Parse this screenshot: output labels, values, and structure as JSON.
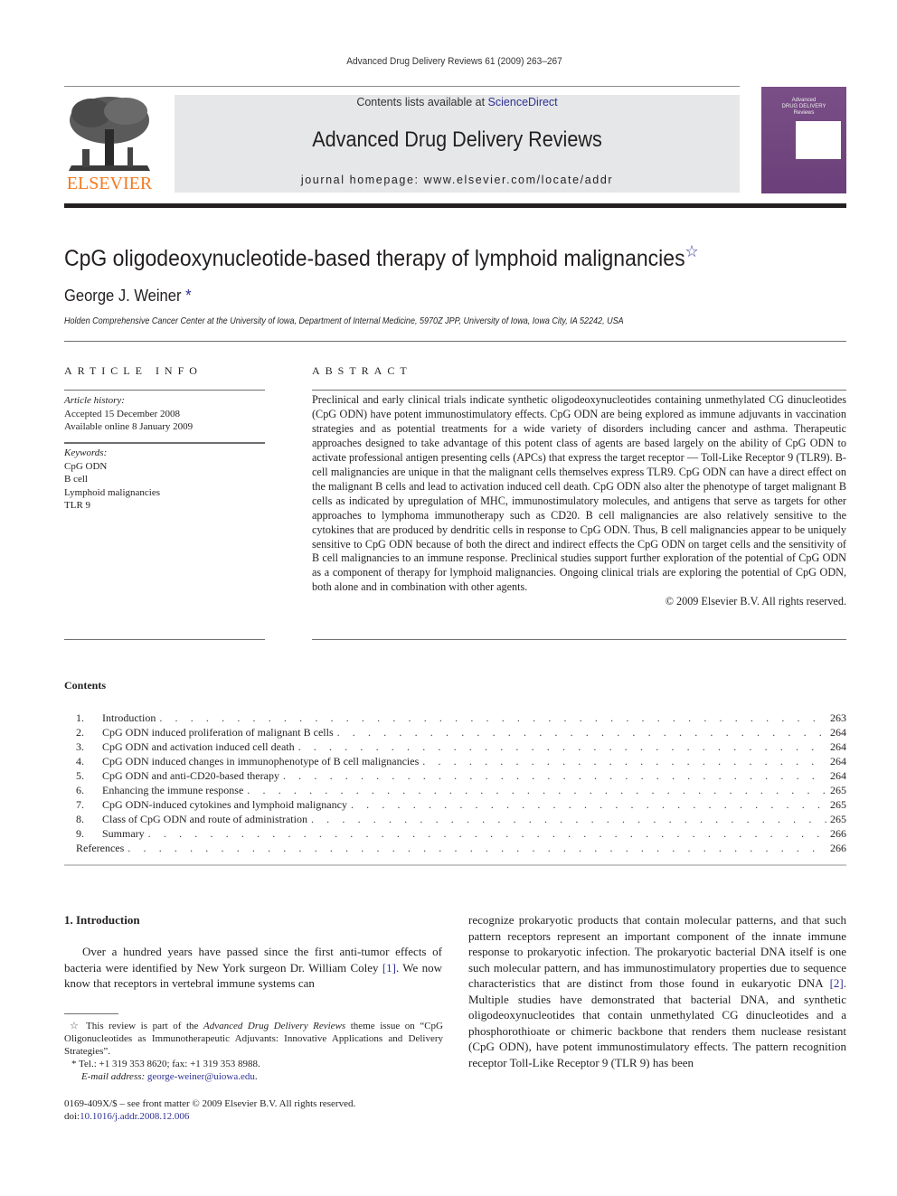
{
  "header": {
    "citation": "Advanced Drug Delivery Reviews 61 (2009) 263–267",
    "contents_prefix": "Contents lists available at ",
    "contents_link": "ScienceDirect",
    "journal_title": "Advanced Drug Delivery Reviews",
    "homepage": "journal homepage: www.elsevier.com/locate/addr",
    "publisher": "ELSEVIER",
    "cover_text_1": "Advanced",
    "cover_text_2": "DRUG DELIVERY",
    "cover_text_3": "Reviews"
  },
  "article": {
    "title": "CpG oligodeoxynucleotide-based therapy of lymphoid malignancies",
    "title_mark": "☆",
    "author": "George J. Weiner",
    "author_mark": "*",
    "affiliation": "Holden Comprehensive Cancer Center at the University of Iowa, Department of Internal Medicine, 5970Z JPP, University of Iowa, Iowa City, IA 52242, USA"
  },
  "article_info": {
    "heading": "ARTICLE INFO",
    "history_label": "Article history:",
    "accepted": "Accepted 15 December 2008",
    "online": "Available online 8 January 2009",
    "keywords_label": "Keywords:",
    "keywords": [
      "CpG ODN",
      "B cell",
      "Lymphoid malignancies",
      "TLR 9"
    ]
  },
  "abstract": {
    "heading": "ABSTRACT",
    "text": "Preclinical and early clinical trials indicate synthetic oligodeoxynucleotides containing unmethylated CG dinucleotides (CpG ODN) have potent immunostimulatory effects. CpG ODN are being explored as immune adjuvants in vaccination strategies and as potential treatments for a wide variety of disorders including cancer and asthma. Therapeutic approaches designed to take advantage of this potent class of agents are based largely on the ability of CpG ODN to activate professional antigen presenting cells (APCs) that express the target receptor — Toll-Like Receptor 9 (TLR9). B-cell malignancies are unique in that the malignant cells themselves express TLR9. CpG ODN can have a direct effect on the malignant B cells and lead to activation induced cell death. CpG ODN also alter the phenotype of target malignant B cells as indicated by upregulation of MHC, immunostimulatory molecules, and antigens that serve as targets for other approaches to lymphoma immunotherapy such as CD20. B cell malignancies are also relatively sensitive to the cytokines that are produced by dendritic cells in response to CpG ODN. Thus, B cell malignancies appear to be uniquely sensitive to CpG ODN because of both the direct and indirect effects the CpG ODN on target cells and the sensitivity of B cell malignancies to an immune response. Preclinical studies support further exploration of the potential of CpG ODN as a component of therapy for lymphoid malignancies. Ongoing clinical trials are exploring the potential of CpG ODN, both alone and in combination with other agents.",
    "copyright": "© 2009 Elsevier B.V. All rights reserved."
  },
  "contents": {
    "heading": "Contents",
    "items": [
      {
        "num": "1.",
        "title": "Introduction",
        "page": "263"
      },
      {
        "num": "2.",
        "title": "CpG ODN induced proliferation of malignant B cells",
        "page": "264"
      },
      {
        "num": "3.",
        "title": "CpG ODN and activation induced cell death",
        "page": "264"
      },
      {
        "num": "4.",
        "title": "CpG ODN induced changes in immunophenotype of B cell malignancies",
        "page": "264"
      },
      {
        "num": "5.",
        "title": "CpG ODN and anti-CD20-based therapy",
        "page": "264"
      },
      {
        "num": "6.",
        "title": "Enhancing the immune response",
        "page": "265"
      },
      {
        "num": "7.",
        "title": "CpG ODN-induced cytokines and lymphoid malignancy",
        "page": "265"
      },
      {
        "num": "8.",
        "title": "Class of CpG ODN and route of administration",
        "page": "265"
      },
      {
        "num": "9.",
        "title": "Summary",
        "page": "266"
      },
      {
        "num": "",
        "title": "References",
        "page": "266"
      }
    ],
    "dots": ". . . . . . . . . . . . . . . . . . . . . . . . . . . . . . . . . . . . . . . . . . . . . . . . . . . . . . . . . . . . . . . . . . . . . . . . . . . . . . . . . . . . . . . . . . . . . . . . . . . . . . . . . . . . . ."
  },
  "intro": {
    "heading": "1. Introduction",
    "col1_text": "Over a hundred years have passed since the first anti-tumor effects of bacteria were identified by New York surgeon Dr. William Coley ",
    "ref1": "[1]",
    "col1_tail": ". We now know that receptors in vertebral immune systems can",
    "col2_text": "recognize prokaryotic products that contain molecular patterns, and that such pattern receptors represent an important component of the innate immune response to prokaryotic infection. The prokaryotic bacterial DNA itself is one such molecular pattern, and has immunostimulatory properties due to sequence characteristics that are distinct from those found in eukaryotic DNA ",
    "ref2": "[2]",
    "col2_tail": ". Multiple studies have demonstrated that bacterial DNA, and synthetic oligodeoxynucleotides that contain unmethylated CG dinucleotides and a phosphorothioate or chimeric backbone that renders them nuclease resistant (CpG ODN), have potent immunostimulatory effects. The pattern recognition receptor Toll-Like Receptor 9 (TLR 9) has been"
  },
  "footnotes": {
    "star_mark": "☆",
    "star_text_1": " This review is part of the ",
    "star_journal": "Advanced Drug Delivery Reviews",
    "star_text_2": " theme issue on “CpG Oligonucleotides as Immunotherapeutic Adjuvants: Innovative Applications and Delivery Strategies”.",
    "ast_mark": "*",
    "tel": " Tel.: +1 319 353 8620; fax: +1 319 353 8988.",
    "email_label": "E-mail address:",
    "email": "george-weiner@uiowa.edu",
    "front_matter": "0169-409X/$ – see front matter © 2009 Elsevier B.V. All rights reserved.",
    "doi_label": "doi:",
    "doi": "10.1016/j.addr.2008.12.006"
  },
  "colors": {
    "link": "#2e3192",
    "elsevier_orange": "#f47a20",
    "banner_gray": "#e6e7e8",
    "cover_purple": "#7a4e86"
  }
}
